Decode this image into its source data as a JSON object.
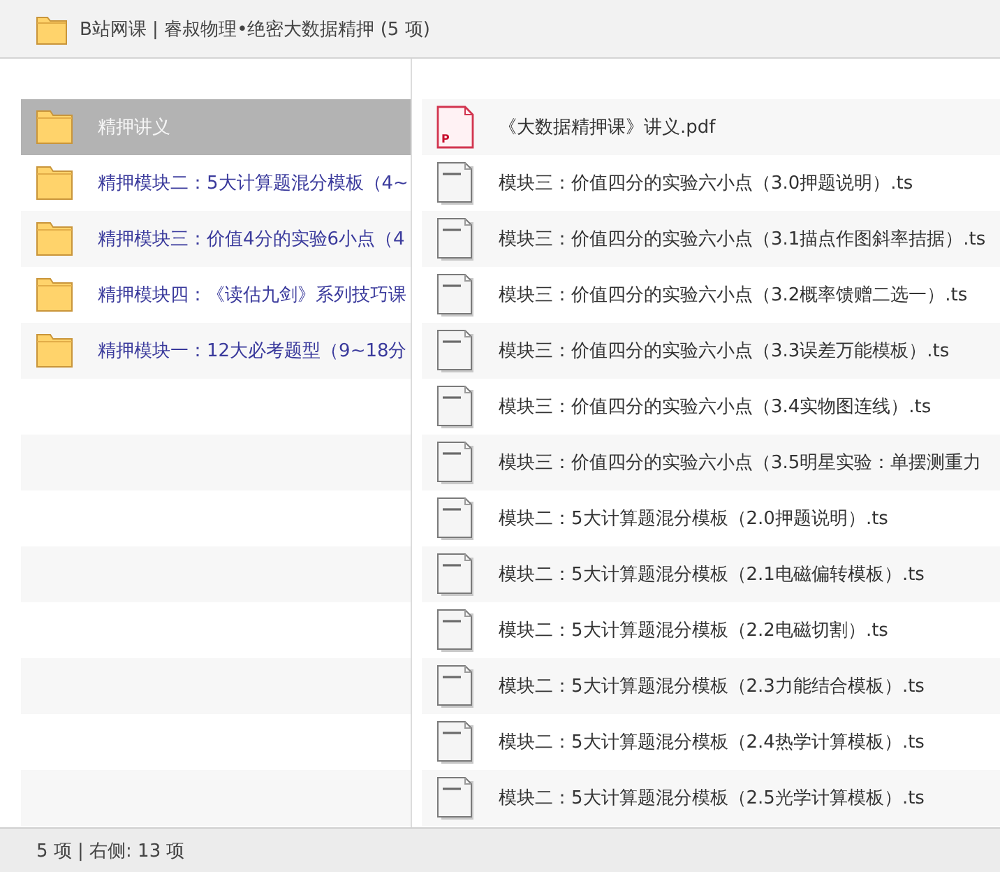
{
  "window": {
    "title": "B站网课 | 睿叔物理•绝密大数据精押 (5 项)"
  },
  "folders": [
    {
      "name": "精押讲义",
      "selected": true
    },
    {
      "name": "精押模块二：5大计算题混分模板（4~",
      "selected": false
    },
    {
      "name": "精押模块三：价值4分的实验6小点（4",
      "selected": false
    },
    {
      "name": "精押模块四：《读估九剑》系列技巧课",
      "selected": false
    },
    {
      "name": "精押模块一：12大必考题型（9~18分",
      "selected": false
    }
  ],
  "files": [
    {
      "kind": "pdf",
      "icon_letter": "P",
      "name": "《大数据精押课》讲义.pdf",
      "selected": false
    },
    {
      "kind": "document",
      "name": "模块三：价值四分的实验六小点（3.0押题说明）.ts",
      "selected": false
    },
    {
      "kind": "document",
      "name": "模块三：价值四分的实验六小点（3.1描点作图斜率拮据）.ts",
      "selected": false
    },
    {
      "kind": "document",
      "name": "模块三：价值四分的实验六小点（3.2概率馈赠二选一）.ts",
      "selected": false
    },
    {
      "kind": "document",
      "name": "模块三：价值四分的实验六小点（3.3误差万能模板）.ts",
      "selected": false
    },
    {
      "kind": "document",
      "name": "模块三：价值四分的实验六小点（3.4实物图连线）.ts",
      "selected": false
    },
    {
      "kind": "document",
      "name": "模块三：价值四分的实验六小点（3.5明星实验：单摆测重力",
      "selected": false
    },
    {
      "kind": "document",
      "name": "模块二：5大计算题混分模板（2.0押题说明）.ts",
      "selected": false
    },
    {
      "kind": "document",
      "name": "模块二：5大计算题混分模板（2.1电磁偏转模板）.ts",
      "selected": false
    },
    {
      "kind": "document",
      "name": "模块二：5大计算题混分模板（2.2电磁切割）.ts",
      "selected": false
    },
    {
      "kind": "document",
      "name": "模块二：5大计算题混分模板（2.3力能结合模板）.ts",
      "selected": false
    },
    {
      "kind": "document",
      "name": "模块二：5大计算题混分模板（2.4热学计算模板）.ts",
      "selected": false
    },
    {
      "kind": "document",
      "name": "模块二：5大计算题混分模板（2.5光学计算模板）.ts",
      "selected": false
    }
  ],
  "status_bar": {
    "text": "5 项 | 右侧: 13 项"
  }
}
